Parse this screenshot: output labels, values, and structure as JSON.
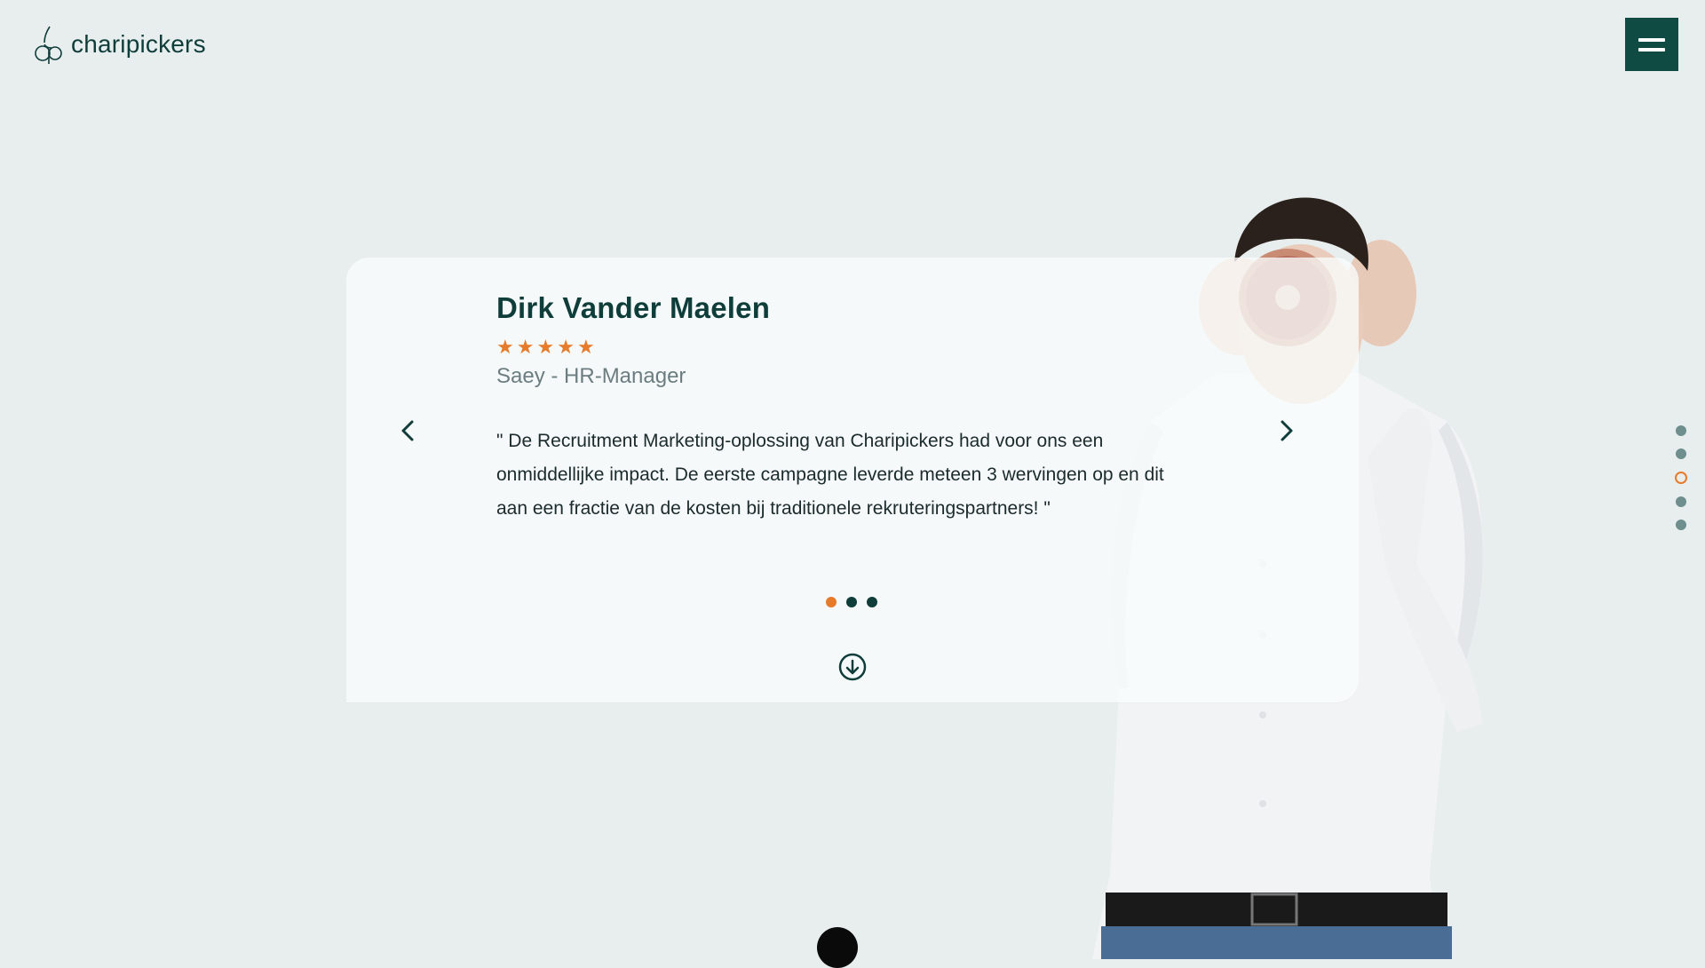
{
  "brand": {
    "name": "charipickers"
  },
  "testimonial": {
    "name": "Dirk Vander Maelen",
    "rating": 5,
    "stars": [
      "★",
      "★",
      "★",
      "★",
      "★"
    ],
    "role": "Saey - HR-Manager",
    "quote_line1": "\" De Recruitment Marketing-oplossing van Charipickers had voor ons een",
    "quote_line2": "onmiddellijke impact. De eerste campagne leverde meteen 3 wervingen op en dit",
    "quote_line3": "aan een fractie van de kosten bij traditionele rekruteringspartners! \""
  },
  "carousel": {
    "slide_count": 3,
    "active_index": 0
  },
  "section_nav": {
    "count": 5,
    "active_index": 2
  },
  "colors": {
    "background": "#e8eeee",
    "primary": "#0f3d3a",
    "menu_button": "#0f4a43",
    "accent": "#e57b2b",
    "muted": "#6b7d80"
  },
  "icons": {
    "menu": "hamburger-icon",
    "prev": "chevron-left-icon",
    "next": "chevron-right-icon",
    "scroll": "arrow-down-circle-icon"
  }
}
